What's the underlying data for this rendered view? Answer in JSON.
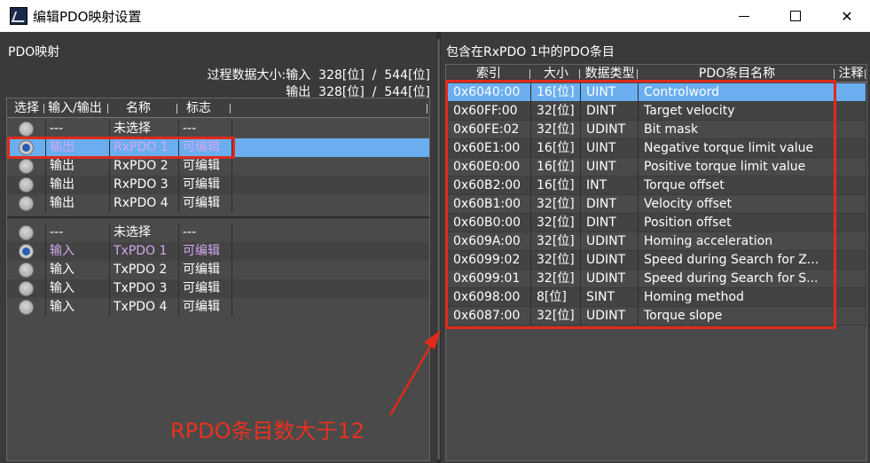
{
  "window": {
    "title": "编辑PDO映射设置",
    "icons": {
      "app": "app-icon",
      "minimize": "minimize-icon",
      "maximize": "maximize-icon",
      "close": "close-icon"
    },
    "close_glyph": "✕"
  },
  "left": {
    "title": "PDO映射",
    "size_line1": "过程数据大小:输入  328[位]  /  544[位]",
    "size_line2": "输出  328[位]  /  544[位]",
    "columns": [
      "选择",
      "输入/输出",
      "名称",
      "标志"
    ],
    "output_rows": [
      {
        "io": "---",
        "name": "未选择",
        "flag": "---",
        "radio": "off"
      },
      {
        "io": "输出",
        "name": "RxPDO 1",
        "flag": "可编辑",
        "radio": "on",
        "selected": true
      },
      {
        "io": "输出",
        "name": "RxPDO 2",
        "flag": "可编辑",
        "radio": "off"
      },
      {
        "io": "输出",
        "name": "RxPDO 3",
        "flag": "可编辑",
        "radio": "off"
      },
      {
        "io": "输出",
        "name": "RxPDO 4",
        "flag": "可编辑",
        "radio": "off"
      }
    ],
    "input_rows": [
      {
        "io": "---",
        "name": "未选择",
        "flag": "---",
        "radio": "off"
      },
      {
        "io": "输入",
        "name": "TxPDO 1",
        "flag": "可编辑",
        "radio": "on",
        "purple": true
      },
      {
        "io": "输入",
        "name": "TxPDO 2",
        "flag": "可编辑",
        "radio": "off"
      },
      {
        "io": "输入",
        "name": "TxPDO 3",
        "flag": "可编辑",
        "radio": "off"
      },
      {
        "io": "输入",
        "name": "TxPDO 4",
        "flag": "可编辑",
        "radio": "off"
      }
    ]
  },
  "right": {
    "title": "包含在RxPDO 1中的PDO条目",
    "columns": [
      "索引",
      "大小",
      "数据类型",
      "PDO条目名称",
      "注释"
    ],
    "rows": [
      {
        "index": "0x6040:00",
        "size": "16[位]",
        "type": "UINT",
        "name": "Controlword"
      },
      {
        "index": "0x60FF:00",
        "size": "32[位]",
        "type": "DINT",
        "name": "Target velocity"
      },
      {
        "index": "0x60FE:02",
        "size": "32[位]",
        "type": "UDINT",
        "name": "Bit mask"
      },
      {
        "index": "0x60E1:00",
        "size": "16[位]",
        "type": "UINT",
        "name": "Negative torque limit value"
      },
      {
        "index": "0x60E0:00",
        "size": "16[位]",
        "type": "UINT",
        "name": "Positive torque limit value"
      },
      {
        "index": "0x60B2:00",
        "size": "16[位]",
        "type": "INT",
        "name": "Torque offset"
      },
      {
        "index": "0x60B1:00",
        "size": "32[位]",
        "type": "DINT",
        "name": "Velocity offset"
      },
      {
        "index": "0x60B0:00",
        "size": "32[位]",
        "type": "DINT",
        "name": "Position offset"
      },
      {
        "index": "0x609A:00",
        "size": "32[位]",
        "type": "UDINT",
        "name": "Homing acceleration"
      },
      {
        "index": "0x6099:02",
        "size": "32[位]",
        "type": "UDINT",
        "name": "Speed during Search for Z..."
      },
      {
        "index": "0x6099:01",
        "size": "32[位]",
        "type": "UDINT",
        "name": "Speed during Search for S..."
      },
      {
        "index": "0x6098:00",
        "size": "8[位]",
        "type": "SINT",
        "name": "Homing method"
      },
      {
        "index": "0x6087:00",
        "size": "32[位]",
        "type": "UDINT",
        "name": "Torque slope"
      }
    ]
  },
  "annotation": {
    "text": "RPDO条目数大于12",
    "color": "#e8321e"
  }
}
